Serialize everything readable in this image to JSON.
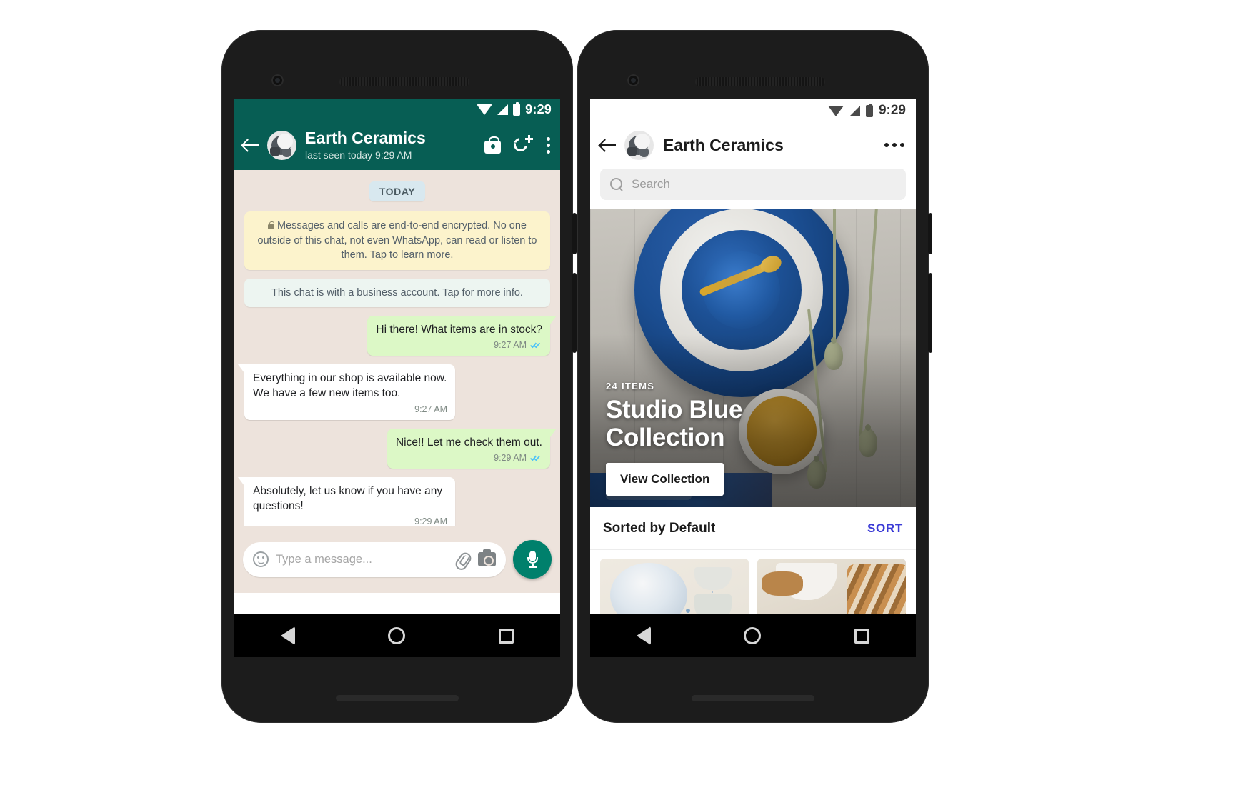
{
  "left_phone": {
    "status_bar": {
      "time": "9:29",
      "icons": [
        "wifi-icon",
        "signal-icon",
        "battery-icon"
      ]
    },
    "header": {
      "back": "back-arrow-icon",
      "avatar": "contact-avatar",
      "title": "Earth Ceramics",
      "subtitle": "last seen today 9:29 AM",
      "actions": [
        "shopping-bag-icon",
        "call-add-icon",
        "overflow-menu-icon"
      ]
    },
    "day_divider": "TODAY",
    "system_messages": [
      {
        "kind": "encryption",
        "text": "Messages and calls are end-to-end encrypted. No one outside of this chat, not even WhatsApp, can read or listen to them. Tap to learn more."
      },
      {
        "kind": "business",
        "text": "This chat is with a business account. Tap for more info."
      }
    ],
    "messages": [
      {
        "direction": "out",
        "text": "Hi there! What items are in stock?",
        "time": "9:27 AM",
        "status": "read"
      },
      {
        "direction": "in",
        "text": "Everything in our shop is available now. We have a few new items too.",
        "time": "9:27 AM",
        "status": ""
      },
      {
        "direction": "out",
        "text": "Nice!! Let me check them out.",
        "time": "9:29 AM",
        "status": "read"
      },
      {
        "direction": "in",
        "text": "Absolutely, let us know if you have any questions!",
        "time": "9:29 AM",
        "status": ""
      }
    ],
    "composer": {
      "emoji_icon": "emoji-smile-icon",
      "placeholder": "Type a message...",
      "attach_icon": "paperclip-icon",
      "camera_icon": "camera-icon",
      "mic_icon": "microphone-icon"
    },
    "nav_bar": [
      "back-triangle-icon",
      "home-circle-icon",
      "recents-square-icon"
    ]
  },
  "right_phone": {
    "status_bar": {
      "time": "9:29",
      "icons": [
        "wifi-icon",
        "signal-icon",
        "battery-icon"
      ]
    },
    "header": {
      "back": "back-arrow-icon",
      "avatar": "business-avatar",
      "title": "Earth Ceramics",
      "overflow": "overflow-menu-icon"
    },
    "search": {
      "icon": "search-icon",
      "placeholder": "Search",
      "value": ""
    },
    "hero": {
      "item_count": "24 ITEMS",
      "title": "Studio Blue Collection",
      "cta": "View Collection"
    },
    "sort_bar": {
      "label": "Sorted by Default",
      "action": "SORT",
      "action_color": "#3b3bd6"
    },
    "products": [
      {
        "name": "light-blue-bowl-and-cups"
      },
      {
        "name": "navy-bowl-with-towel"
      }
    ],
    "nav_bar": [
      "back-triangle-icon",
      "home-circle-icon",
      "recents-square-icon"
    ]
  },
  "theme": {
    "whatsapp_teal": "#075E54",
    "whatsapp_status_teal": "#075E54",
    "chat_background": "#EDE3DC",
    "outgoing_bubble": "#DCF8C6",
    "incoming_bubble": "#FFFFFF",
    "encryption_notice": "#FCF3CC",
    "business_notice": "#EDF5F1",
    "mic_fab": "#00806C",
    "tick_blue": "#4FC3F7",
    "page_background": "#FFFFFF"
  }
}
